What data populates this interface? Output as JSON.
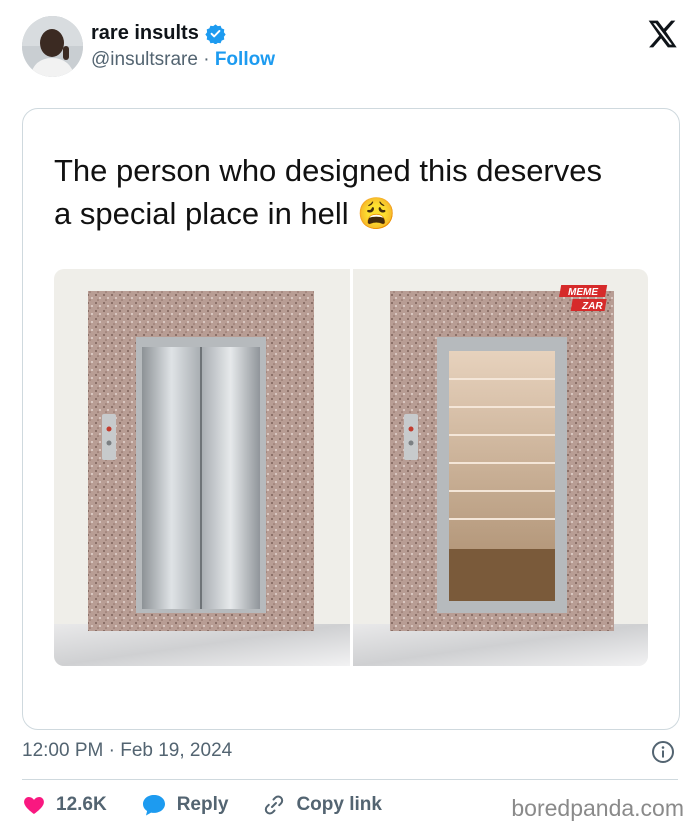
{
  "author": {
    "display_name": "rare insults",
    "handle": "@insultsrare",
    "separator": " · ",
    "follow_label": "Follow",
    "verified": true,
    "verified_color": "#1d9bf0"
  },
  "platform_logo": "x-logo",
  "post": {
    "text_line1": "The person who designed  this deserves",
    "text_line2": "a special place in hell",
    "emoji": "😩",
    "image": {
      "watermark_line1": "MEME",
      "watermark_line2": "ZAR",
      "left_panel": "closed elevator doors",
      "right_panel": "open elevator revealing stairs"
    }
  },
  "meta": {
    "time": "12:00 PM",
    "separator": " · ",
    "date": "Feb 19, 2024"
  },
  "actions": {
    "likes": "12.6K",
    "reply_label": "Reply",
    "copy_label": "Copy link",
    "like_color": "#f91880",
    "reply_color": "#1d9bf0"
  },
  "watermark": "boredpanda.com"
}
